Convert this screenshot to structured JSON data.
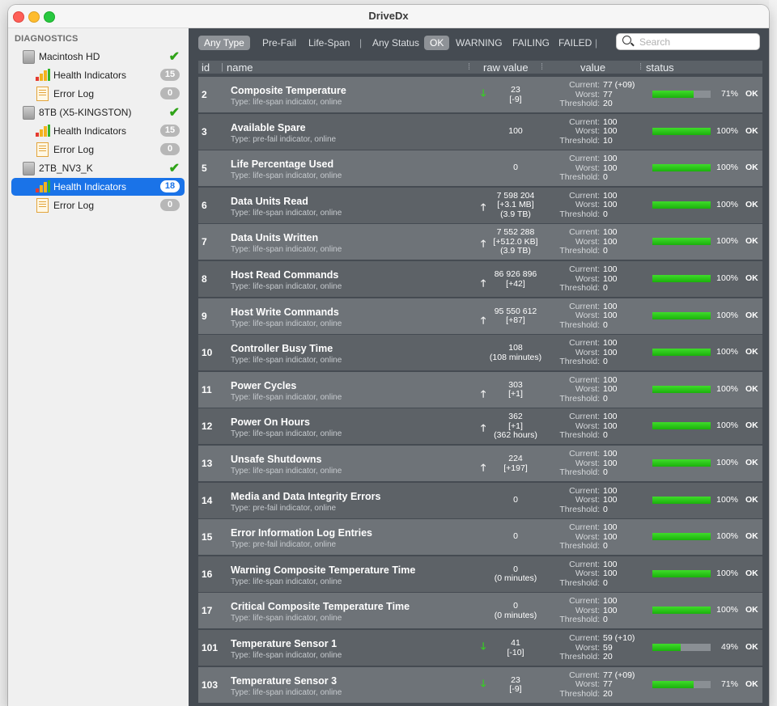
{
  "app": {
    "title": "DriveDx"
  },
  "sidebar": {
    "header": "DIAGNOSTICS",
    "drives": [
      {
        "name": "Macintosh HD",
        "ok": true,
        "items": [
          {
            "label": "Health Indicators",
            "badge": "15"
          },
          {
            "label": "Error Log",
            "badge": "0"
          }
        ]
      },
      {
        "name": "8TB (X5-KINGSTON)",
        "ok": true,
        "items": [
          {
            "label": "Health Indicators",
            "badge": "15"
          },
          {
            "label": "Error Log",
            "badge": "0"
          }
        ]
      },
      {
        "name": "2TB_NV3_K",
        "ok": true,
        "items": [
          {
            "label": "Health Indicators",
            "badge": "18",
            "selected": true
          },
          {
            "label": "Error Log",
            "badge": "0"
          }
        ]
      }
    ]
  },
  "filters": {
    "type": [
      "Any Type",
      "Pre-Fail",
      "Life-Span"
    ],
    "status": [
      "Any Status",
      "OK",
      "WARNING",
      "FAILING",
      "FAILED"
    ],
    "search_placeholder": "Search"
  },
  "columns": {
    "id": "id",
    "name": "name",
    "raw": "raw value",
    "value": "value",
    "status": "status"
  },
  "value_labels": {
    "current": "Current:",
    "worst": "Worst:",
    "threshold": "Threshold:"
  },
  "rows": [
    {
      "id": "2",
      "name": "Composite Temperature",
      "type": "Type: life-span indicator, online",
      "trend": "down",
      "raw": [
        "23",
        "[-9]"
      ],
      "current": "77  (+09)",
      "worst": "77",
      "threshold": "20",
      "percent": 71,
      "pct": "71%",
      "status": "OK"
    },
    {
      "id": "3",
      "name": "Available Spare",
      "type": "Type: pre-fail indicator, online",
      "trend": "",
      "raw": [
        "100"
      ],
      "current": "100",
      "worst": "100",
      "threshold": "10",
      "percent": 100,
      "pct": "100%",
      "status": "OK"
    },
    {
      "id": "5",
      "name": "Life Percentage Used",
      "type": "Type: life-span indicator, online",
      "trend": "",
      "raw": [
        "0"
      ],
      "current": "100",
      "worst": "100",
      "threshold": "0",
      "percent": 100,
      "pct": "100%",
      "status": "OK"
    },
    {
      "id": "6",
      "name": "Data Units Read",
      "type": "Type: life-span indicator, online",
      "trend": "up",
      "raw": [
        "7 598 204",
        "[+3.1 MB]",
        "(3.9 TB)"
      ],
      "current": "100",
      "worst": "100",
      "threshold": "0",
      "percent": 100,
      "pct": "100%",
      "status": "OK"
    },
    {
      "id": "7",
      "name": "Data Units Written",
      "type": "Type: life-span indicator, online",
      "trend": "up",
      "raw": [
        "7 552 288",
        "[+512.0 KB]",
        "(3.9 TB)"
      ],
      "current": "100",
      "worst": "100",
      "threshold": "0",
      "percent": 100,
      "pct": "100%",
      "status": "OK"
    },
    {
      "id": "8",
      "name": "Host Read Commands",
      "type": "Type: life-span indicator, online",
      "trend": "up",
      "raw": [
        "86 926 896",
        "[+42]"
      ],
      "current": "100",
      "worst": "100",
      "threshold": "0",
      "percent": 100,
      "pct": "100%",
      "status": "OK"
    },
    {
      "id": "9",
      "name": "Host Write Commands",
      "type": "Type: life-span indicator, online",
      "trend": "up",
      "raw": [
        "95 550 612",
        "[+87]"
      ],
      "current": "100",
      "worst": "100",
      "threshold": "0",
      "percent": 100,
      "pct": "100%",
      "status": "OK"
    },
    {
      "id": "10",
      "name": "Controller Busy Time",
      "type": "Type: life-span indicator, online",
      "trend": "",
      "raw": [
        "108",
        "(108 minutes)"
      ],
      "current": "100",
      "worst": "100",
      "threshold": "0",
      "percent": 100,
      "pct": "100%",
      "status": "OK"
    },
    {
      "id": "11",
      "name": "Power Cycles",
      "type": "Type: life-span indicator, online",
      "trend": "up",
      "raw": [
        "303",
        "[+1]"
      ],
      "current": "100",
      "worst": "100",
      "threshold": "0",
      "percent": 100,
      "pct": "100%",
      "status": "OK"
    },
    {
      "id": "12",
      "name": "Power On Hours",
      "type": "Type: life-span indicator, online",
      "trend": "up",
      "raw": [
        "362",
        "[+1]",
        "(362 hours)"
      ],
      "current": "100",
      "worst": "100",
      "threshold": "0",
      "percent": 100,
      "pct": "100%",
      "status": "OK"
    },
    {
      "id": "13",
      "name": "Unsafe Shutdowns",
      "type": "Type: life-span indicator, online",
      "trend": "up",
      "raw": [
        "224",
        "[+197]"
      ],
      "current": "100",
      "worst": "100",
      "threshold": "0",
      "percent": 100,
      "pct": "100%",
      "status": "OK"
    },
    {
      "id": "14",
      "name": "Media and Data Integrity Errors",
      "type": "Type: pre-fail indicator, online",
      "trend": "",
      "raw": [
        "0"
      ],
      "current": "100",
      "worst": "100",
      "threshold": "0",
      "percent": 100,
      "pct": "100%",
      "status": "OK"
    },
    {
      "id": "15",
      "name": "Error Information Log Entries",
      "type": "Type: pre-fail indicator, online",
      "trend": "",
      "raw": [
        "0"
      ],
      "current": "100",
      "worst": "100",
      "threshold": "0",
      "percent": 100,
      "pct": "100%",
      "status": "OK"
    },
    {
      "id": "16",
      "name": "Warning Composite Temperature Time",
      "type": "Type: life-span indicator, online",
      "trend": "",
      "raw": [
        "0",
        "(0 minutes)"
      ],
      "current": "100",
      "worst": "100",
      "threshold": "0",
      "percent": 100,
      "pct": "100%",
      "status": "OK"
    },
    {
      "id": "17",
      "name": "Critical Composite Temperature Time",
      "type": "Type: life-span indicator, online",
      "trend": "",
      "raw": [
        "0",
        "(0 minutes)"
      ],
      "current": "100",
      "worst": "100",
      "threshold": "0",
      "percent": 100,
      "pct": "100%",
      "status": "OK"
    },
    {
      "id": "101",
      "name": "Temperature Sensor 1",
      "type": "Type: life-span indicator, online",
      "trend": "down",
      "raw": [
        "41",
        "[-10]"
      ],
      "current": "59  (+10)",
      "worst": "59",
      "threshold": "20",
      "percent": 49,
      "pct": "49%",
      "status": "OK"
    },
    {
      "id": "103",
      "name": "Temperature Sensor 3",
      "type": "Type: life-span indicator, online",
      "trend": "down",
      "raw": [
        "23",
        "[-9]"
      ],
      "current": "77  (+09)",
      "worst": "77",
      "threshold": "20",
      "percent": 71,
      "pct": "71%",
      "status": "OK"
    }
  ],
  "colors": {
    "bar_fill": "#22c412",
    "selection": "#1a73e8",
    "check": "#2fa318"
  }
}
